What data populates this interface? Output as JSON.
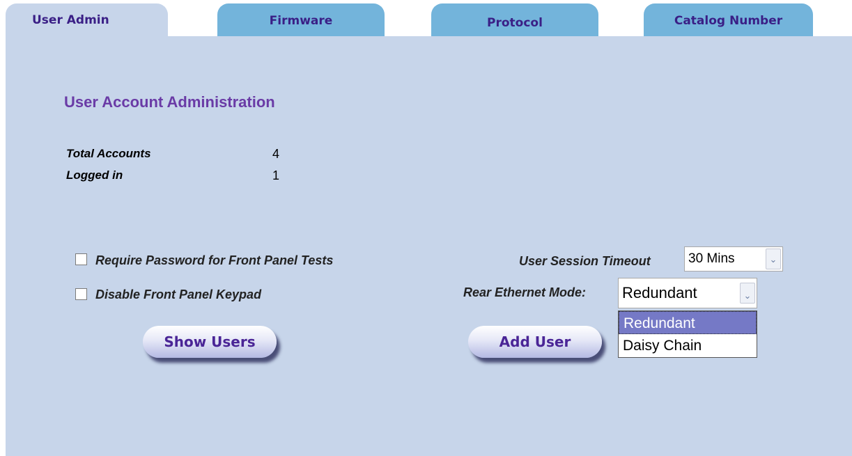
{
  "tabs": [
    {
      "label": "User Admin",
      "active": true
    },
    {
      "label": "Firmware",
      "active": false
    },
    {
      "label": "Protocol",
      "active": false
    },
    {
      "label": "Catalog Number",
      "active": false
    }
  ],
  "main": {
    "title": "User Account Administration",
    "stats": [
      {
        "label": "Total Accounts",
        "value": "4"
      },
      {
        "label": "Logged in",
        "value": "1"
      }
    ],
    "options": {
      "require_password": {
        "label": "Require Password for Front Panel Tests",
        "checked": false
      },
      "disable_keypad": {
        "label": "Disable Front Panel Keypad",
        "checked": false
      }
    },
    "session_timeout": {
      "label": "User Session Timeout",
      "value": "30 Mins"
    },
    "ethernet_mode": {
      "label": "Rear Ethernet Mode:",
      "value": "Redundant",
      "dropdown_open": true,
      "options": [
        "Redundant",
        "Daisy Chain"
      ],
      "highlighted_option": "Redundant"
    },
    "buttons": {
      "show_users": "Show Users",
      "add_user": "Add User"
    }
  },
  "colors": {
    "tab_inactive": "#73b4db",
    "panel_bg": "#c7d5ea",
    "title_purple": "#6a3ba6",
    "tab_text": "#3a1f86",
    "dropdown_highlight": "#7579c6"
  },
  "icons": {
    "select_arrow": "chevron-down-icon"
  }
}
